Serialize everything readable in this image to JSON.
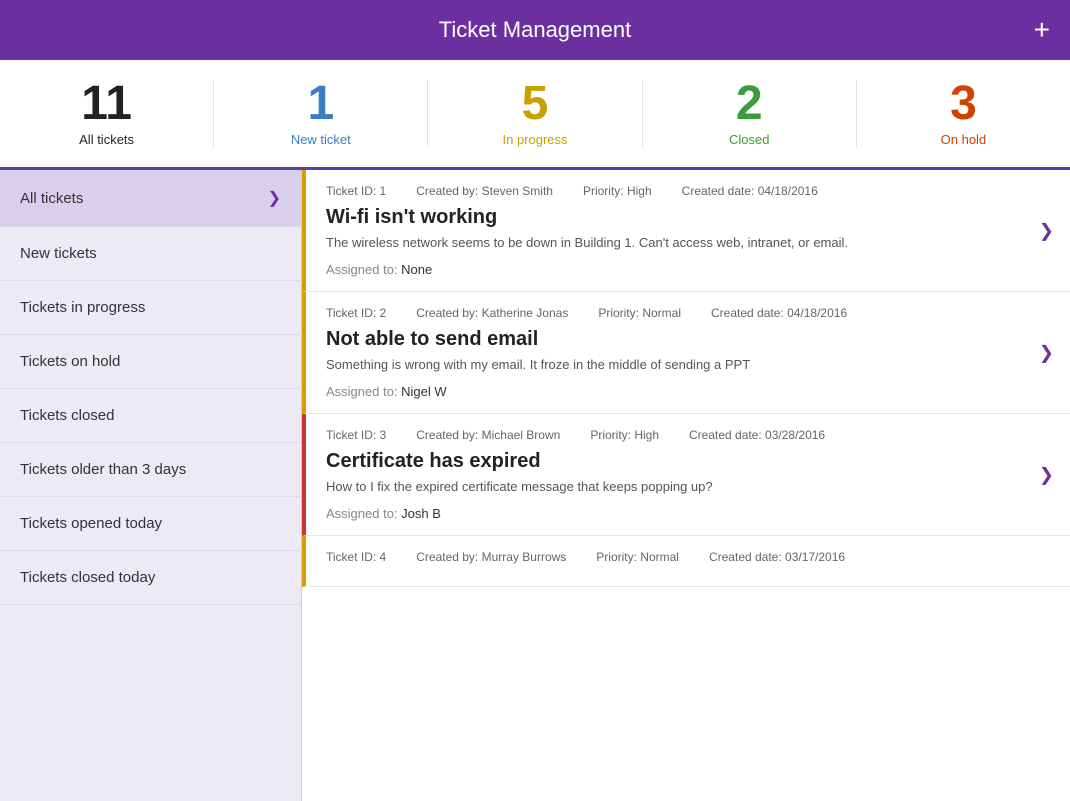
{
  "header": {
    "title": "Ticket Management",
    "plus_icon": "+"
  },
  "stats": [
    {
      "id": "all",
      "number": "11",
      "label": "All tickets",
      "color": "color-black"
    },
    {
      "id": "new",
      "number": "1",
      "label": "New ticket",
      "color": "color-blue"
    },
    {
      "id": "inprogress",
      "number": "5",
      "label": "In progress",
      "color": "color-yellow"
    },
    {
      "id": "closed",
      "number": "2",
      "label": "Closed",
      "color": "color-green"
    },
    {
      "id": "onhold",
      "number": "3",
      "label": "On hold",
      "color": "color-orange"
    }
  ],
  "sidebar": {
    "items": [
      {
        "id": "all",
        "label": "All tickets",
        "active": true
      },
      {
        "id": "new",
        "label": "New tickets",
        "active": false
      },
      {
        "id": "inprogress",
        "label": "Tickets in progress",
        "active": false
      },
      {
        "id": "onhold",
        "label": "Tickets on hold",
        "active": false
      },
      {
        "id": "closed",
        "label": "Tickets closed",
        "active": false
      },
      {
        "id": "older",
        "label": "Tickets older than 3 days",
        "active": false
      },
      {
        "id": "today",
        "label": "Tickets opened today",
        "active": false
      },
      {
        "id": "closedtoday",
        "label": "Tickets closed today",
        "active": false
      }
    ]
  },
  "tickets": [
    {
      "id": "1",
      "meta_id": "Ticket ID: 1",
      "created_by": "Created by: Steven Smith",
      "priority": "Priority: High",
      "created_date": "Created date: 04/18/2016",
      "title": "Wi-fi isn't working",
      "description": "The wireless network seems to be down in Building 1. Can't access web, intranet, or email.",
      "assigned_label": "Assigned to:",
      "assigned_to": "None",
      "priority_class": "priority-high"
    },
    {
      "id": "2",
      "meta_id": "Ticket ID: 2",
      "created_by": "Created by: Katherine Jonas",
      "priority": "Priority: Normal",
      "created_date": "Created date: 04/18/2016",
      "title": "Not able to send email",
      "description": "Something is wrong with my email. It froze in the middle of sending a PPT",
      "assigned_label": "Assigned to:",
      "assigned_to": "Nigel W",
      "priority_class": "priority-normal"
    },
    {
      "id": "3",
      "meta_id": "Ticket ID: 3",
      "created_by": "Created by: Michael Brown",
      "priority": "Priority: High",
      "created_date": "Created date: 03/28/2016",
      "title": "Certificate has expired",
      "description": "How to I fix the expired certificate message that keeps popping up?",
      "assigned_label": "Assigned to:",
      "assigned_to": "Josh B",
      "priority_class": "priority-high-red"
    },
    {
      "id": "4",
      "meta_id": "Ticket ID: 4",
      "created_by": "Created by: Murray Burrows",
      "priority": "Priority: Normal",
      "created_date": "Created date: 03/17/2016",
      "title": "",
      "description": "",
      "assigned_label": "",
      "assigned_to": "",
      "priority_class": "priority-normal"
    }
  ]
}
